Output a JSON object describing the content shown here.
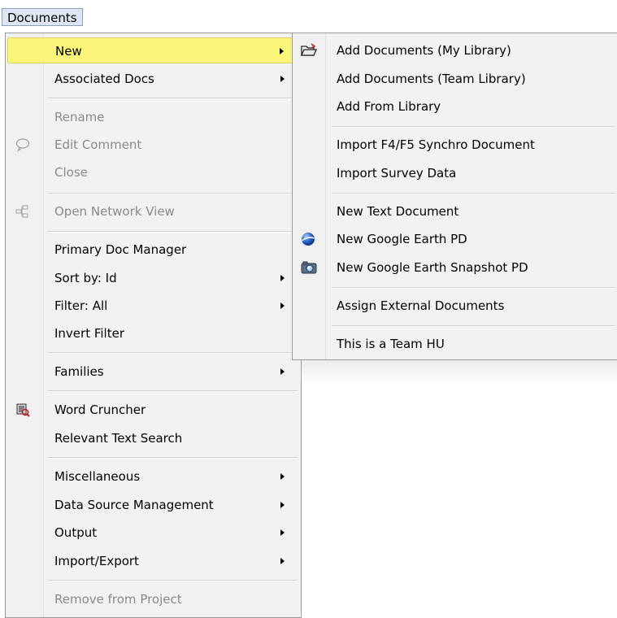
{
  "menubar": {
    "title": "Documents"
  },
  "main_menu": {
    "items": [
      {
        "label": "New",
        "submenu": true,
        "highlight": true
      },
      {
        "label": "Associated Docs",
        "submenu": true
      },
      {
        "label": "Rename",
        "disabled": true
      },
      {
        "label": "Edit Comment",
        "disabled": true,
        "icon": "comment-icon"
      },
      {
        "label": "Close",
        "disabled": true
      },
      {
        "label": "Open Network View",
        "disabled": true,
        "icon": "network-icon"
      },
      {
        "label": "Primary Doc Manager"
      },
      {
        "label": "Sort by: Id",
        "submenu": true
      },
      {
        "label": "Filter: All",
        "submenu": true
      },
      {
        "label": "Invert Filter"
      },
      {
        "label": "Families",
        "submenu": true
      },
      {
        "label": "Word Cruncher",
        "icon": "word-cruncher-icon"
      },
      {
        "label": "Relevant Text Search"
      },
      {
        "label": "Miscellaneous",
        "submenu": true
      },
      {
        "label": "Data Source Management",
        "submenu": true
      },
      {
        "label": "Output",
        "submenu": true
      },
      {
        "label": "Import/Export",
        "submenu": true
      },
      {
        "label": "Remove from Project",
        "disabled": true
      }
    ]
  },
  "sub_menu": {
    "items": [
      {
        "label": "Add Documents (My Library)",
        "icon": "open-folder-icon"
      },
      {
        "label": "Add Documents (Team Library)"
      },
      {
        "label": "Add From Library"
      },
      {
        "label": "Import F4/F5 Synchro Document"
      },
      {
        "label": "Import Survey Data"
      },
      {
        "label": "New Text Document"
      },
      {
        "label": "New Google Earth PD",
        "icon": "google-earth-icon"
      },
      {
        "label": "New Google Earth Snapshot PD",
        "icon": "camera-icon"
      },
      {
        "label": "Assign External Documents"
      },
      {
        "label": "This is a Team HU"
      }
    ]
  },
  "colors": {
    "highlight": "#fbf67a",
    "disabled_text": "#8a8a8a",
    "menu_bg": "#f2f2f2"
  }
}
